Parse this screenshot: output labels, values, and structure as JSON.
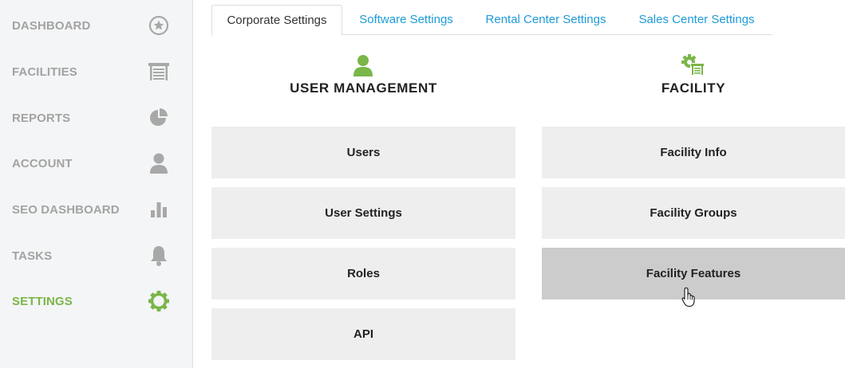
{
  "sidebar": {
    "items": [
      {
        "label": "DASHBOARD",
        "icon": "star-circle-icon",
        "active": false
      },
      {
        "label": "FACILITIES",
        "icon": "facility-building-icon",
        "active": false
      },
      {
        "label": "REPORTS",
        "icon": "pie-chart-icon",
        "active": false
      },
      {
        "label": "ACCOUNT",
        "icon": "user-icon",
        "active": false
      },
      {
        "label": "SEO DASHBOARD",
        "icon": "bar-chart-icon",
        "active": false
      },
      {
        "label": "TASKS",
        "icon": "bell-icon",
        "active": false
      },
      {
        "label": "SETTINGS",
        "icon": "gear-icon",
        "active": true
      }
    ]
  },
  "tabs": [
    {
      "label": "Corporate Settings",
      "active": true
    },
    {
      "label": "Software Settings",
      "active": false
    },
    {
      "label": "Rental Center Settings",
      "active": false
    },
    {
      "label": "Sales Center Settings",
      "active": false
    }
  ],
  "sections": {
    "user_management": {
      "title": "USER MANAGEMENT",
      "icon": "user-icon",
      "buttons": [
        "Users",
        "User Settings",
        "Roles",
        "API"
      ]
    },
    "facility": {
      "title": "FACILITY",
      "icon": "facility-gear-icon",
      "buttons": [
        "Facility Info",
        "Facility Groups",
        "Facility Features"
      ]
    }
  },
  "colors": {
    "accent_green": "#7ab648",
    "link_blue": "#1e9bd7",
    "sidebar_text": "#a3a3a3",
    "sidebar_icon": "#a8a8a8",
    "card_bg": "#eeeeee",
    "card_hover": "#cccccc"
  }
}
